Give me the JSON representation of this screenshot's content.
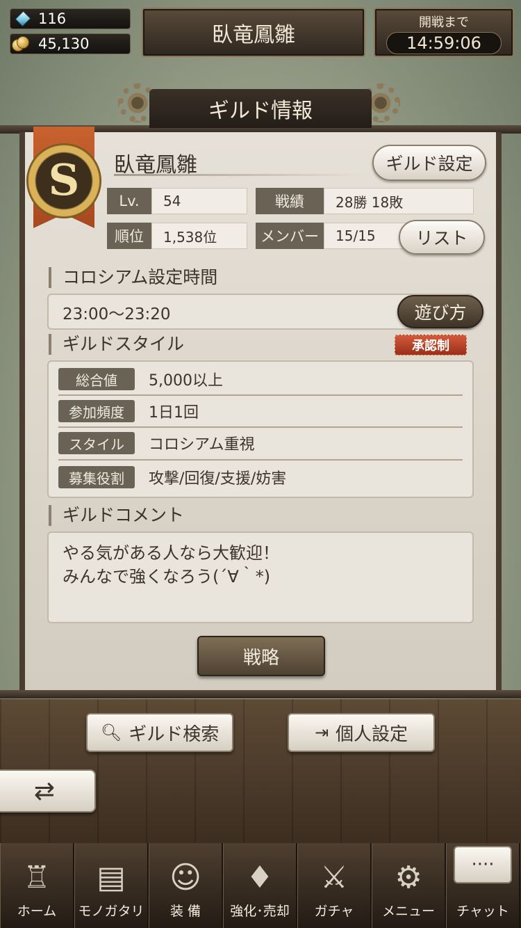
{
  "top": {
    "gems": "116",
    "coins": "45,130",
    "guild_title": "臥竜鳳雛",
    "timer_label": "開戦まで",
    "timer_value": "14:59:06"
  },
  "panel": {
    "header": "ギルド情報",
    "rank": "S",
    "guild_name": "臥竜鳳雛",
    "settings_button": "ギルド設定",
    "stats": {
      "level_label": "Lv.",
      "level_value": "54",
      "record_label": "戦績",
      "record_value": "28勝 18敗",
      "rank_label": "順位",
      "rank_value": "1,538位",
      "members_label": "メンバー",
      "members_value": "15/15",
      "list_button": "リスト"
    },
    "colosseum": {
      "title": "コロシアム設定時間",
      "time": "23:00〜23:20",
      "howto_button": "遊び方"
    },
    "style": {
      "title": "ギルドスタイル",
      "approval_badge": "承認制",
      "rows": [
        {
          "label": "総合値",
          "value": "5,000以上"
        },
        {
          "label": "参加頻度",
          "value": "1日1回"
        },
        {
          "label": "スタイル",
          "value": "コロシアム重視"
        },
        {
          "label": "募集役割",
          "value": "攻撃/回復/支援/妨害"
        }
      ]
    },
    "comment": {
      "title": "ギルドコメント",
      "text": "やる気がある人なら大歓迎！\nみんなで強くなろう(´∀｀*)"
    },
    "strategy_button": "戦略"
  },
  "actions": {
    "search_button": "ギルド検索",
    "personal_button": "個人設定"
  },
  "nav": {
    "items": [
      "ホーム",
      "モノガタリ",
      "装 備",
      "強化･売却",
      "ガチャ",
      "メニュー",
      "チャット"
    ]
  },
  "icons": [
    "gem-icon",
    "coin-icon",
    "search-icon",
    "enter-icon",
    "back-arrow-icon",
    "castle-icon",
    "book-icon",
    "puppet-icon",
    "helmet-icon",
    "swords-icon",
    "gears-icon",
    "chat-bubble-icon"
  ]
}
